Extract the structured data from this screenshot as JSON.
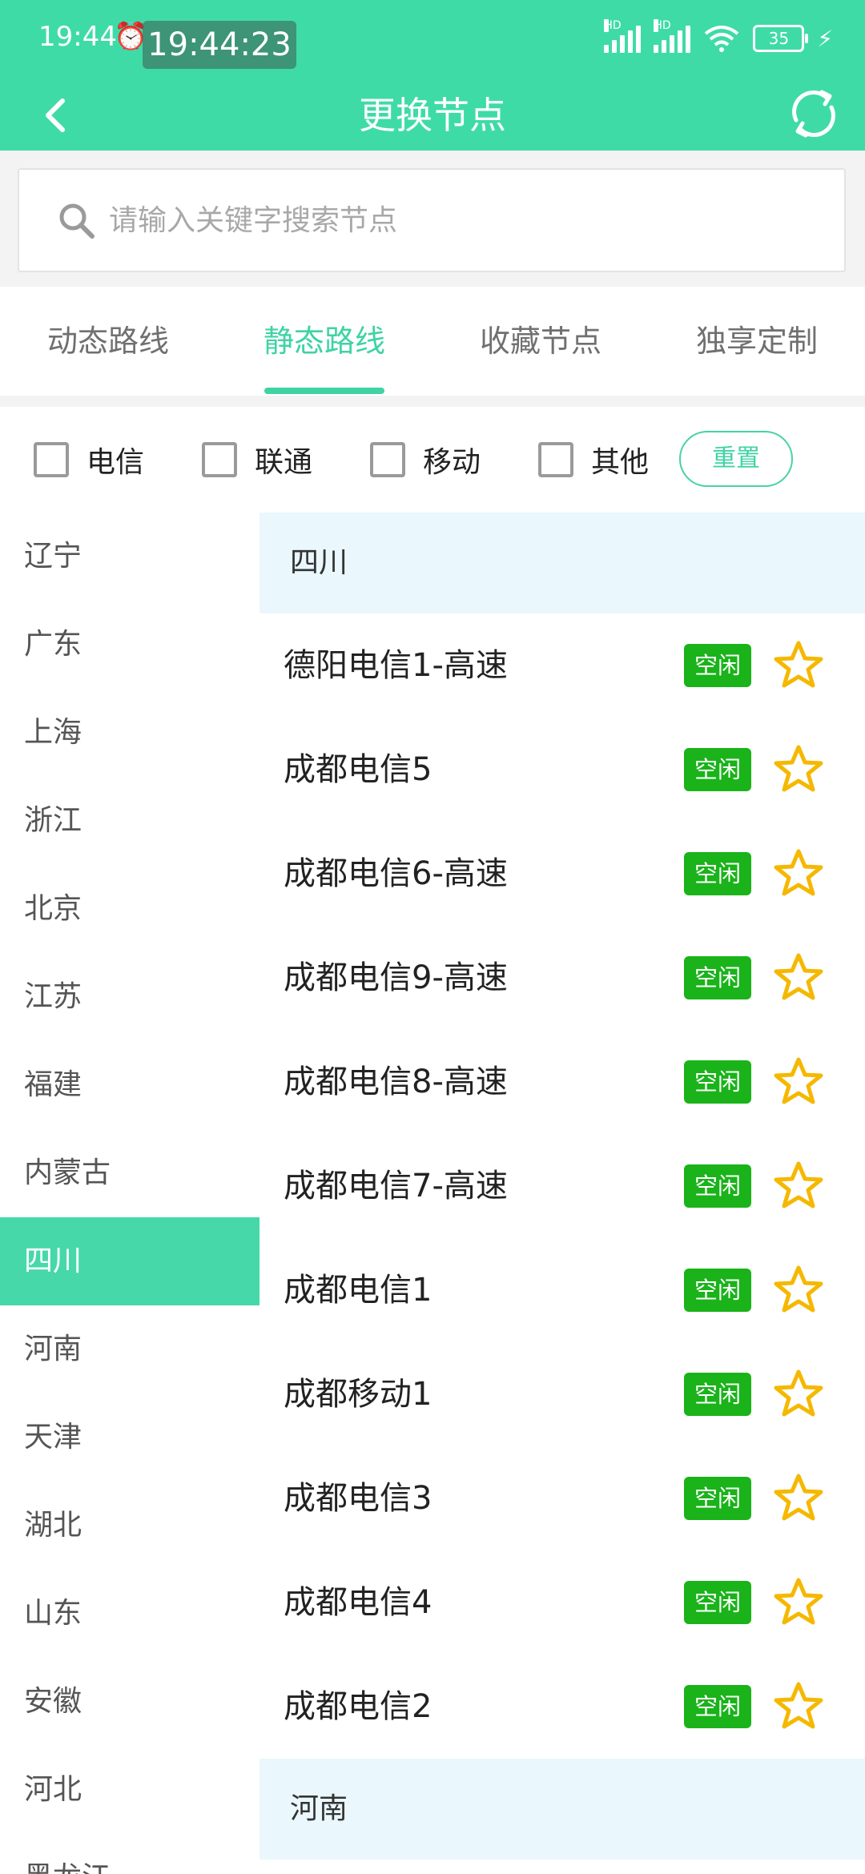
{
  "status_bar": {
    "time": "19:44",
    "timer": "19:44:23",
    "net1": "HD",
    "net2": "HD",
    "battery": "35"
  },
  "app_bar": {
    "title": "更换节点"
  },
  "search": {
    "placeholder": "请输入关键字搜索节点"
  },
  "tabs": [
    "动态路线",
    "静态路线",
    "收藏节点",
    "独享定制"
  ],
  "filters": {
    "items": [
      "电信",
      "联通",
      "移动",
      "其他"
    ],
    "reset_label": "重置"
  },
  "sidebar": {
    "items": [
      "辽宁",
      "广东",
      "上海",
      "浙江",
      "北京",
      "江苏",
      "福建",
      "内蒙古",
      "四川",
      "河南",
      "天津",
      "湖北",
      "山东",
      "安徽",
      "河北",
      "黑龙江"
    ],
    "active": "四川"
  },
  "list": {
    "groups": [
      {
        "title": "四川",
        "nodes": [
          {
            "name": "德阳电信1-高速",
            "status": "空闲"
          },
          {
            "name": "成都电信5",
            "status": "空闲"
          },
          {
            "name": "成都电信6-高速",
            "status": "空闲"
          },
          {
            "name": "成都电信9-高速",
            "status": "空闲"
          },
          {
            "name": "成都电信8-高速",
            "status": "空闲"
          },
          {
            "name": "成都电信7-高速",
            "status": "空闲"
          },
          {
            "name": "成都电信1",
            "status": "空闲"
          },
          {
            "name": "成都移动1",
            "status": "空闲"
          },
          {
            "name": "成都电信3",
            "status": "空闲"
          },
          {
            "name": "成都电信4",
            "status": "空闲"
          },
          {
            "name": "成都电信2",
            "status": "空闲"
          }
        ]
      },
      {
        "title": "河南",
        "nodes": []
      }
    ]
  },
  "colors": {
    "accent": "#3fdba7",
    "badge": "#1ab31a",
    "star": "#f5b800",
    "group_bg": "#eaf7fd"
  }
}
